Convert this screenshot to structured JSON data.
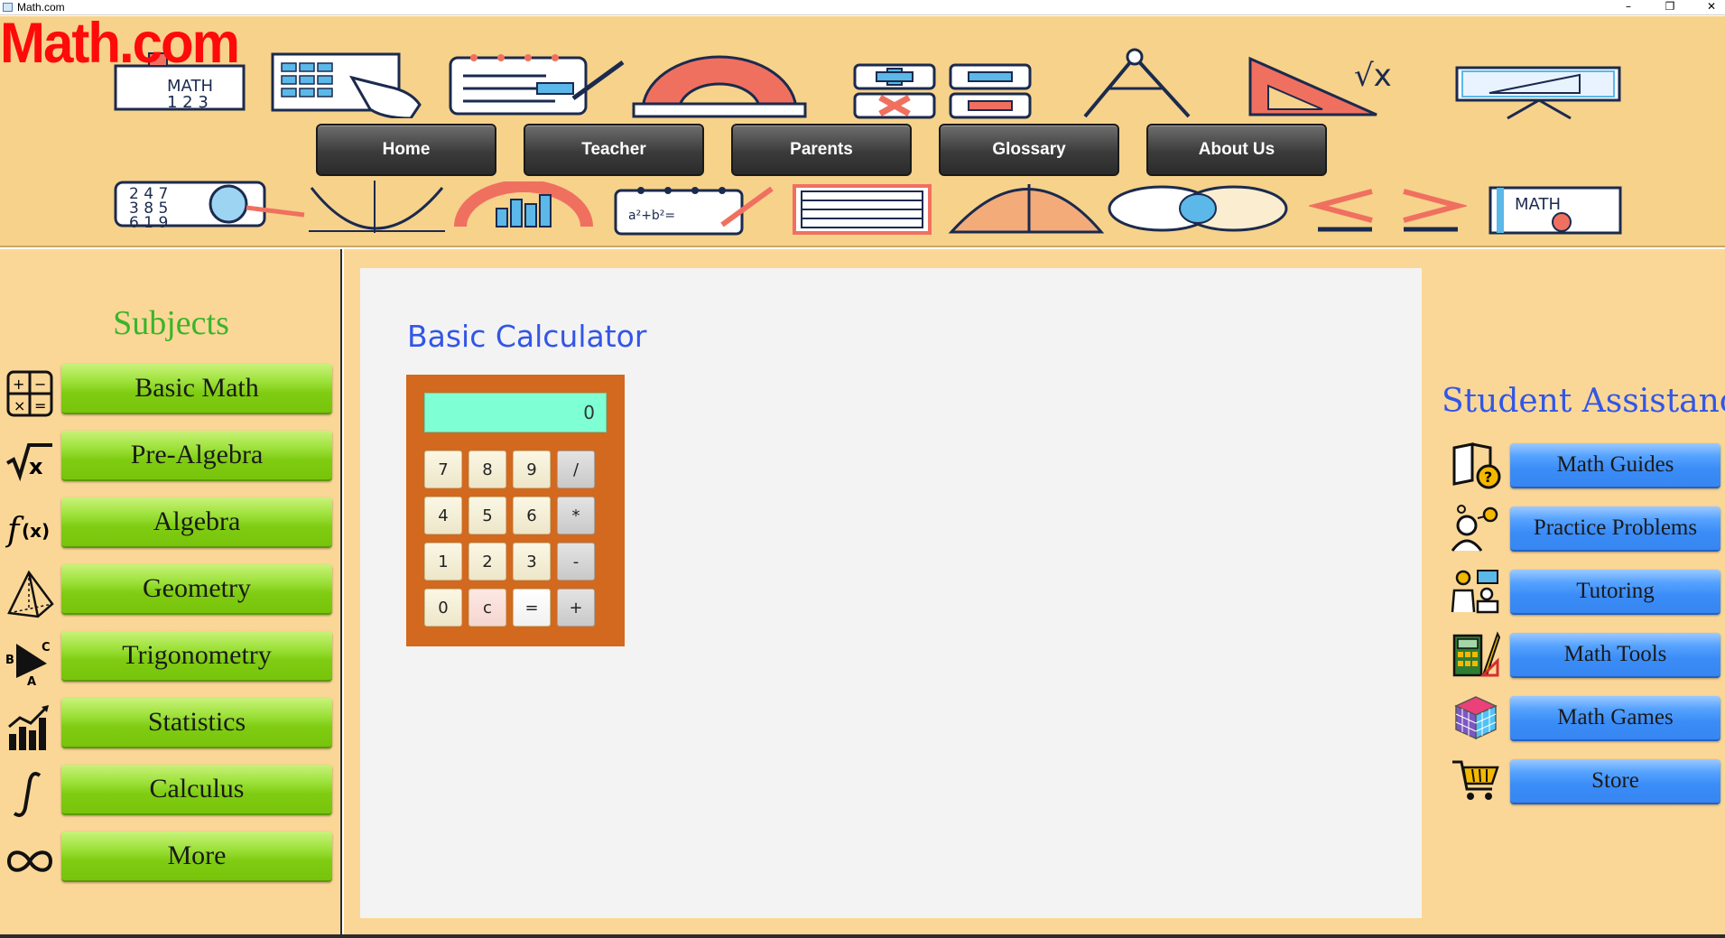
{
  "window": {
    "title": "Math.com",
    "controls": {
      "minimize": "–",
      "maximize": "❐",
      "close": "✕"
    }
  },
  "header": {
    "logo": "Math.com",
    "nav": [
      {
        "label": "Home"
      },
      {
        "label": "Teacher"
      },
      {
        "label": "Parents"
      },
      {
        "label": "Glossary"
      },
      {
        "label": "About Us"
      }
    ],
    "colors": {
      "background": "#f6d28b",
      "logo": "#ff0a0a"
    }
  },
  "sidebar": {
    "title": "Subjects",
    "items": [
      {
        "label": "Basic Math",
        "icon": "operations-icon"
      },
      {
        "label": "Pre-Algebra",
        "icon": "square-root-icon"
      },
      {
        "label": "Algebra",
        "icon": "function-icon"
      },
      {
        "label": "Geometry",
        "icon": "pyramid-icon"
      },
      {
        "label": "Trigonometry",
        "icon": "triangle-icon"
      },
      {
        "label": "Statistics",
        "icon": "bar-chart-icon"
      },
      {
        "label": "Calculus",
        "icon": "integral-icon"
      },
      {
        "label": "More",
        "icon": "infinity-icon"
      }
    ],
    "colors": {
      "title": "#39b52a",
      "button": "#7fcc12"
    }
  },
  "calculator": {
    "title": "Basic Calculator",
    "display": "0",
    "keys": [
      "7",
      "8",
      "9",
      "/",
      "4",
      "5",
      "6",
      "*",
      "1",
      "2",
      "3",
      "-",
      "0",
      "c",
      "=",
      "+"
    ],
    "colors": {
      "body": "#d2691e",
      "display": "#7fffd4",
      "title": "#3256e6"
    }
  },
  "assistance": {
    "title": "Student Assistance",
    "items": [
      {
        "label": "Math Guides",
        "icon": "book-question-icon"
      },
      {
        "label": "Practice Problems",
        "icon": "thinking-person-icon"
      },
      {
        "label": "Tutoring",
        "icon": "tutor-icon"
      },
      {
        "label": "Math Tools",
        "icon": "calculator-tools-icon"
      },
      {
        "label": "Math Games",
        "icon": "rubiks-cube-icon"
      },
      {
        "label": "Store",
        "icon": "shopping-cart-icon"
      }
    ],
    "colors": {
      "title": "#3256e6",
      "button": "#3a8cf7"
    }
  }
}
